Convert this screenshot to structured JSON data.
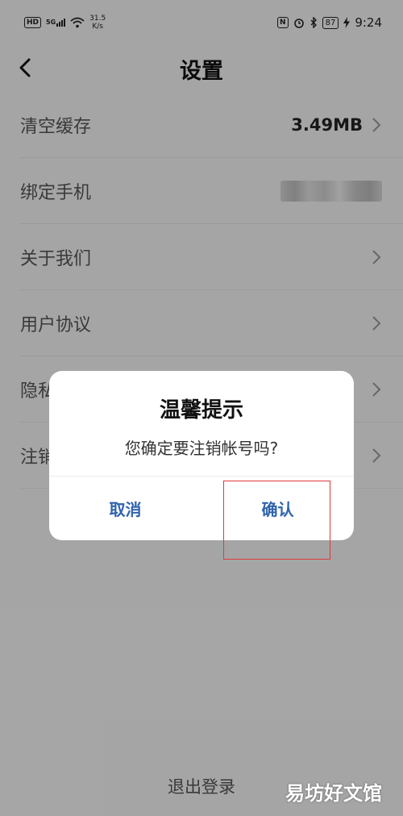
{
  "status_bar": {
    "hd": "HD",
    "signal_label": "5G",
    "net_speed_value": "31.5",
    "net_speed_unit": "K/s",
    "battery": "87",
    "time": "9:24"
  },
  "header": {
    "title": "设置"
  },
  "settings": {
    "items": [
      {
        "label": "清空缓存",
        "value": "3.49MB"
      },
      {
        "label": "绑定手机",
        "value": ""
      },
      {
        "label": "关于我们",
        "value": ""
      },
      {
        "label": "用户协议",
        "value": ""
      },
      {
        "label": "隐私",
        "value": ""
      },
      {
        "label": "注销",
        "value": ""
      }
    ]
  },
  "logout_label": "退出登录",
  "dialog": {
    "title": "温馨提示",
    "message": "您确定要注销帐号吗?",
    "cancel_label": "取消",
    "confirm_label": "确认"
  },
  "watermark": "易坊好文馆",
  "colors": {
    "accent": "#2f63ad",
    "highlight": "#e03a3a"
  }
}
